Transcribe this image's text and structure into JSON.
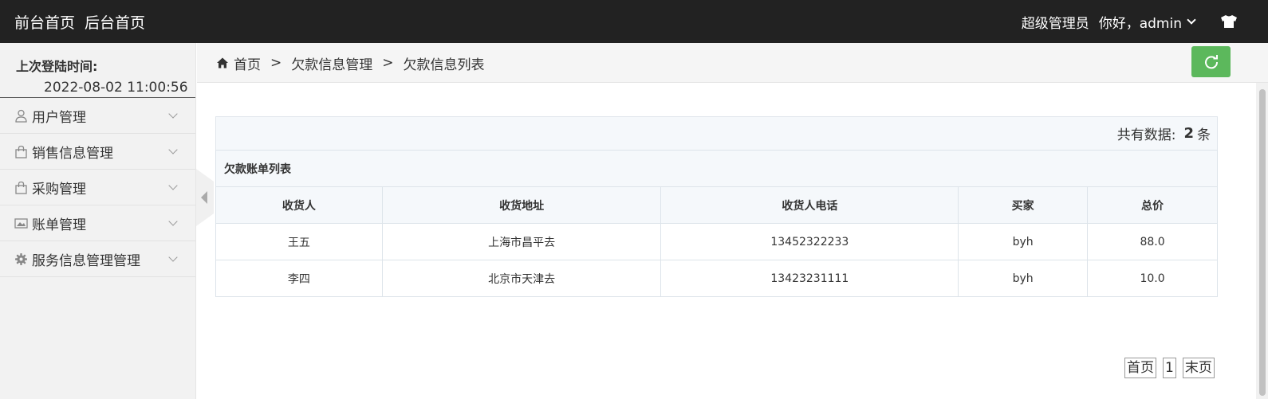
{
  "header": {
    "nav": [
      "前台首页",
      "后台首页"
    ],
    "role": "超级管理员",
    "greeting": "你好，admin"
  },
  "sidebar": {
    "last_login_label": "上次登陆时间:",
    "last_login_time": "2022-08-02 11:00:56",
    "items": [
      {
        "label": "用户管理",
        "icon": "user-icon"
      },
      {
        "label": "销售信息管理",
        "icon": "shopping-bag-icon"
      },
      {
        "label": "采购管理",
        "icon": "shopping-bag-icon"
      },
      {
        "label": "账单管理",
        "icon": "picture-icon"
      },
      {
        "label": "服务信息管理管理",
        "icon": "gear-icon"
      }
    ]
  },
  "breadcrumb": {
    "items": [
      "首页",
      "欠款信息管理",
      "欠款信息列表"
    ],
    "separator": ">"
  },
  "summary": {
    "label": "共有数据:",
    "count": "2",
    "unit": "条"
  },
  "table": {
    "caption": "欠款账单列表",
    "columns": [
      "收货人",
      "收货地址",
      "收货人电话",
      "买家",
      "总价"
    ],
    "rows": [
      [
        "王五",
        "上海市昌平去",
        "13452322233",
        "byh",
        "88.0"
      ],
      [
        "李四",
        "北京市天津去",
        "13423231111",
        "byh",
        "10.0"
      ]
    ]
  },
  "pager": {
    "first": "首页",
    "page": "1",
    "last": "末页"
  },
  "colors": {
    "header_bg": "#222222",
    "refresh_button": "#5cb85c",
    "sidebar_bg": "#f2f2f2"
  }
}
